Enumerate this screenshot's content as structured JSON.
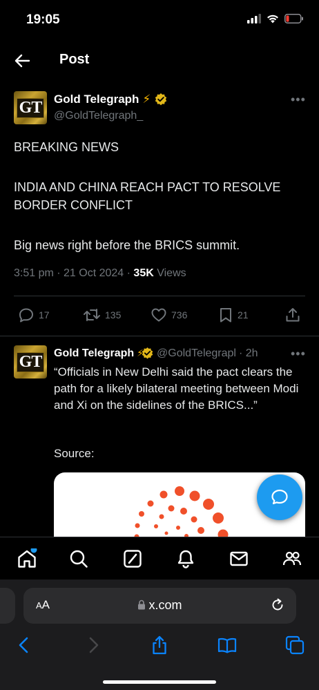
{
  "status": {
    "time": "19:05"
  },
  "nav": {
    "title": "Post"
  },
  "post": {
    "avatar_text": "GT",
    "name": "Gold Telegraph",
    "name_emoji": "⚡",
    "handle": "@GoldTelegraph_",
    "lines": [
      "BREAKING NEWS",
      "INDIA AND CHINA REACH PACT TO RESOLVE",
      "BORDER CONFLICT",
      "Big news right before the BRICS summit."
    ],
    "meta_time": "3:51 pm · 21 Oct 2024 · ",
    "views_count": "35K",
    "views_label": " Views"
  },
  "actions": {
    "replies": "17",
    "reposts": "135",
    "likes": "736",
    "bookmarks": "21"
  },
  "reply": {
    "avatar_text": "GT",
    "name": "Gold Telegraph",
    "name_emoji": "⚡",
    "handle": "@GoldTelegrapl",
    "time": "· 2h",
    "text": "“Officials in New Delhi said the pact clears the path for a likely bilateral meeting between Modi and Xi on the sidelines of the BRICS...”",
    "source": "Source:"
  },
  "browser": {
    "aa_big": "A",
    "aa_small": "A",
    "url": "x.com"
  },
  "colors": {
    "accent": "#1d9bf0",
    "verified": "#e2b719",
    "muted": "#71767b",
    "battery": "#ff3b30"
  }
}
